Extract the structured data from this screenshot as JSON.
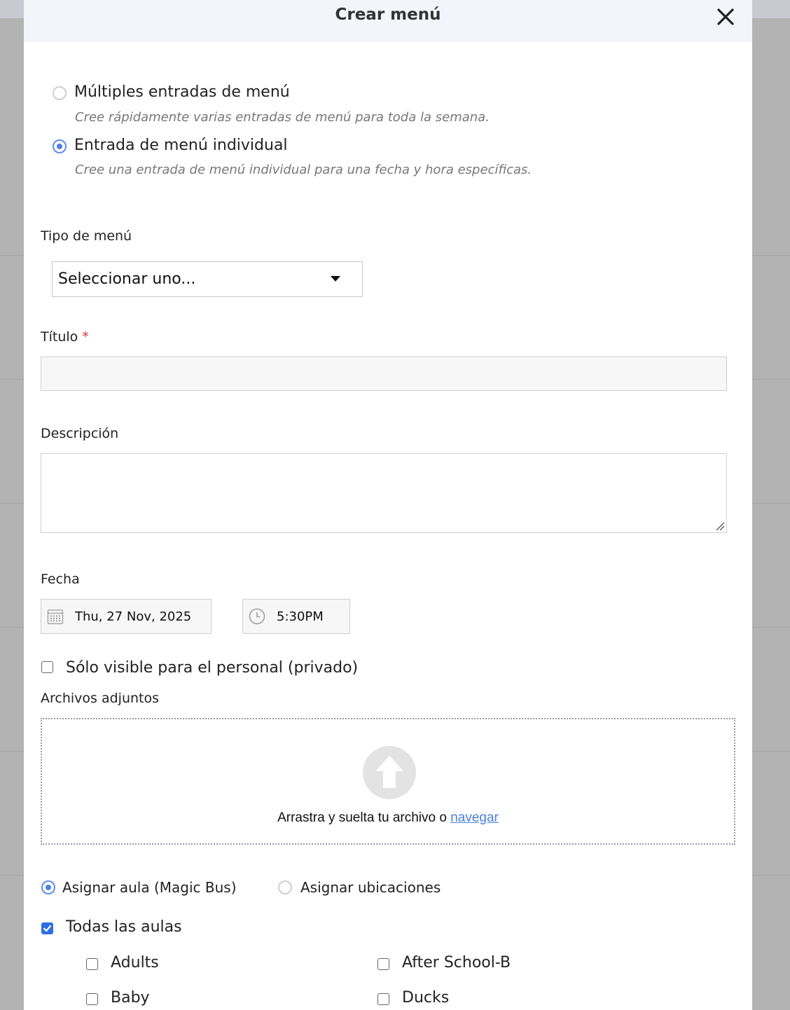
{
  "dialog": {
    "title": "Crear menú"
  },
  "entry_mode": {
    "options": [
      {
        "label": "Múltiples entradas de menú",
        "description": "Cree rápidamente varias entradas de menú para toda la semana.",
        "selected": false
      },
      {
        "label": "Entrada de menú individual",
        "description": "Cree una entrada de menú individual para una fecha y hora específicas.",
        "selected": true
      }
    ]
  },
  "menu_type": {
    "label": "Tipo de menú",
    "selected": "Seleccionar uno..."
  },
  "title_field": {
    "label": "Título",
    "required_mark": "*",
    "value": ""
  },
  "description_field": {
    "label": "Descripción",
    "value": ""
  },
  "date_field": {
    "label": "Fecha",
    "date": "Thu, 27 Nov, 2025",
    "time": "5:30PM"
  },
  "private_checkbox": {
    "label": "Sólo visible para el personal (privado)",
    "checked": false
  },
  "attachments": {
    "label": "Archivos adjuntos",
    "drop_text": "Arrastra y suelta tu archivo o ",
    "browse_link": "navegar"
  },
  "assign": {
    "options": [
      {
        "label": "Asignar aula (Magic Bus)",
        "selected": true
      },
      {
        "label": "Asignar ubicaciones",
        "selected": false
      }
    ],
    "all_rooms": {
      "label": "Todas las aulas",
      "checked": true
    },
    "rooms": [
      {
        "label": "Adults",
        "checked": false
      },
      {
        "label": "After School-B",
        "checked": false
      },
      {
        "label": "Baby",
        "checked": false
      },
      {
        "label": "Ducks",
        "checked": false
      }
    ]
  },
  "colors": {
    "accent": "#4d7fe6",
    "checkbox_checked": "#2f6ee3",
    "required": "#dd3333",
    "header_bg": "#f4f5fa"
  }
}
